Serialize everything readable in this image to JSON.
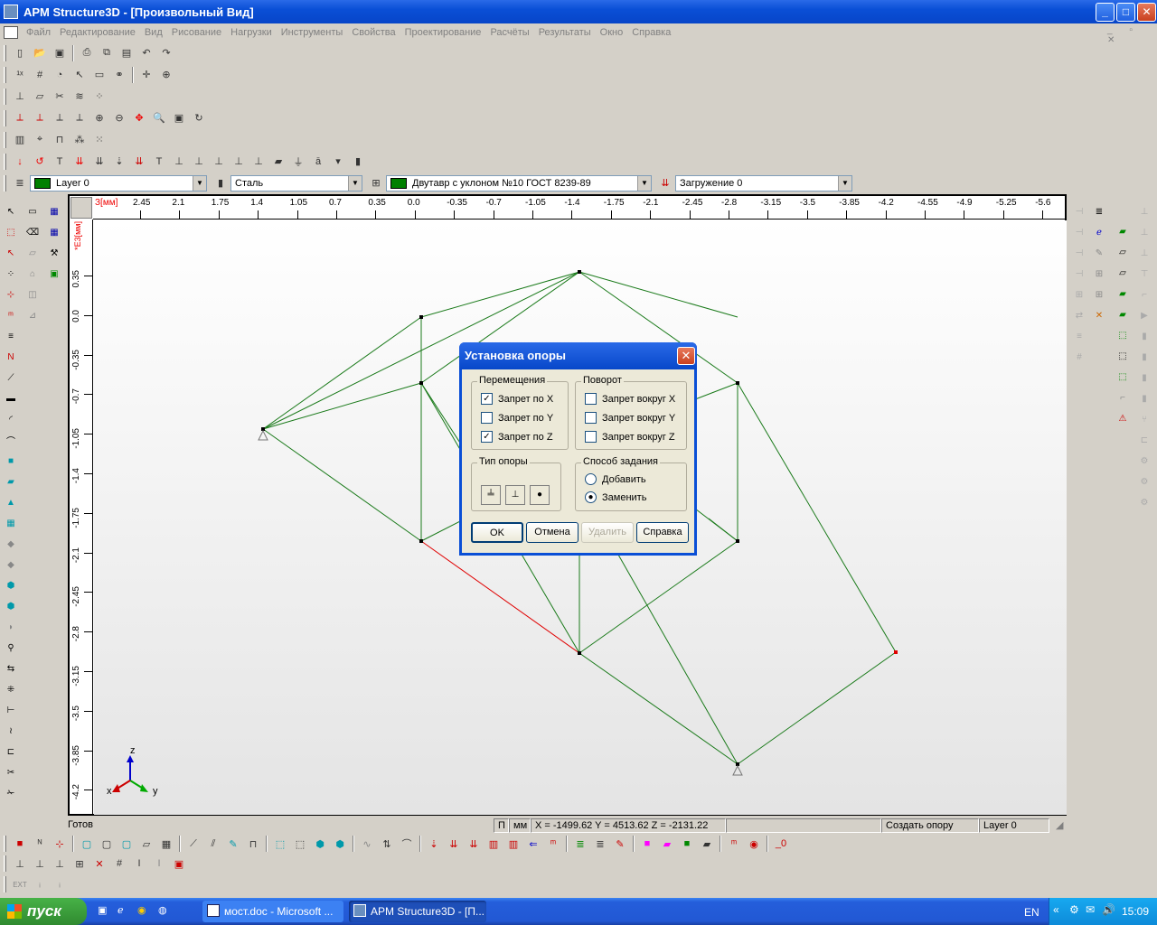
{
  "window": {
    "title": "APM Structure3D - [Произвольный Вид]"
  },
  "menu": [
    "Файл",
    "Редактирование",
    "Вид",
    "Рисование",
    "Нагрузки",
    "Инструменты",
    "Свойства",
    "Проектирование",
    "Расчёты",
    "Результаты",
    "Окно",
    "Справка"
  ],
  "property_bar": {
    "layer": "Layer 0",
    "material": "Сталь",
    "section": "Двутавр с уклоном  №10 ГОСТ 8239-89",
    "loading": "Загружение 0",
    "layer_color": "#008000",
    "section_color": "#008000"
  },
  "ruler": {
    "units_label": "З[мм]",
    "v_units_label": "*Е3[мм]",
    "h_ticks": [
      "2.45",
      "2.1",
      "1.75",
      "1.4",
      "1.05",
      "0.7",
      "0.35",
      "0.0",
      "-0.35",
      "-0.7",
      "-1.05",
      "-1.4",
      "-1.75",
      "-2.1",
      "-2.45",
      "-2.8",
      "-3.15",
      "-3.5",
      "-3.85",
      "-4.2",
      "-4.55",
      "-4.9",
      "-5.25",
      "-5.6"
    ],
    "v_ticks": [
      "0.35",
      "0.0",
      "-0.35",
      "-0.7",
      "-1.05",
      "-1.4",
      "-1.75",
      "-2.1",
      "-2.45",
      "-2.8",
      "-3.15",
      "-3.5",
      "-3.85",
      "-4.2"
    ]
  },
  "axes": {
    "z": "z",
    "x": "x",
    "y": "y"
  },
  "dialog": {
    "title": "Установка опоры",
    "displacements": {
      "label": "Перемещения",
      "items": [
        {
          "label": "Запрет по X",
          "checked": true
        },
        {
          "label": "Запрет по Y",
          "checked": false
        },
        {
          "label": "Запрет по Z",
          "checked": true
        }
      ]
    },
    "rotation": {
      "label": "Поворот",
      "items": [
        {
          "label": "Запрет вокруг X",
          "checked": false
        },
        {
          "label": "Запрет вокруг Y",
          "checked": false
        },
        {
          "label": "Запрет вокруг Z",
          "checked": false
        }
      ]
    },
    "support_type": {
      "label": "Тип опоры"
    },
    "mode": {
      "label": "Способ задания",
      "items": [
        {
          "label": "Добавить",
          "selected": false
        },
        {
          "label": "Заменить",
          "selected": true
        }
      ]
    },
    "buttons": {
      "ok": "OK",
      "cancel": "Отмена",
      "delete": "Удалить",
      "help": "Справка"
    }
  },
  "status": {
    "ready": "Готов",
    "p": "П",
    "units": "мм",
    "coords": "X = -1499.62 Y = 4513.62 Z = -2131.22",
    "command": "Создать опору",
    "layer": "Layer 0"
  },
  "taskbar": {
    "start": "пуск",
    "tasks": [
      "мост.doc - Microsoft ...",
      "APM Structure3D - [П..."
    ],
    "lang": "EN",
    "clock": "15:09"
  }
}
